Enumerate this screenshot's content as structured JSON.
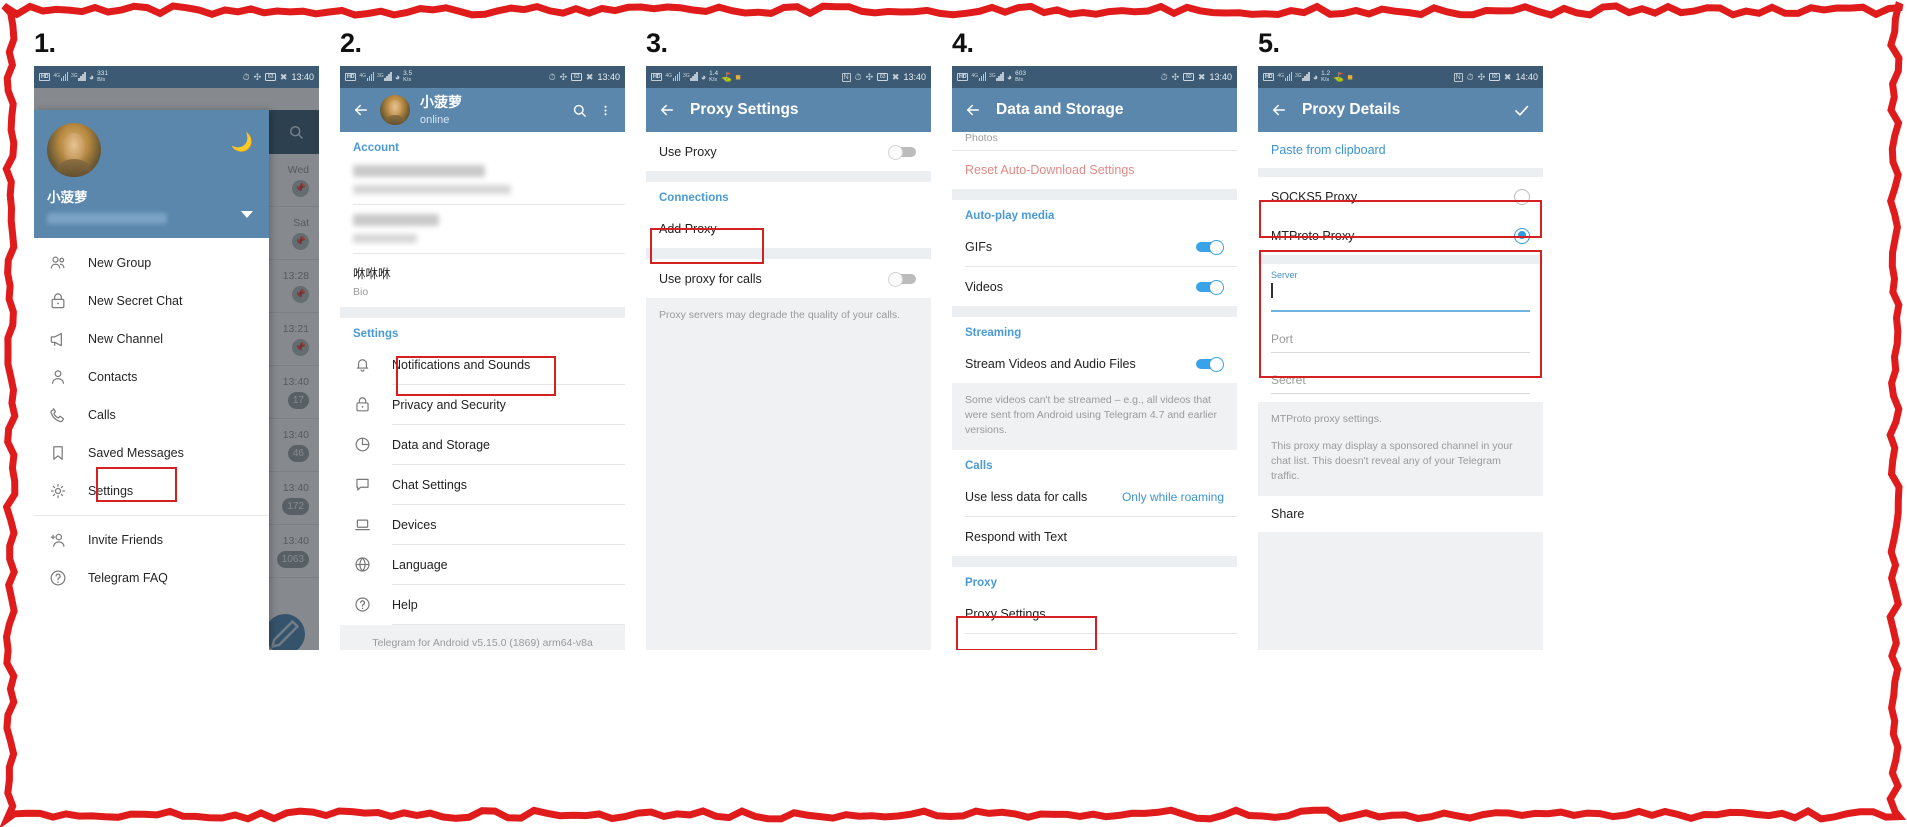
{
  "panels": [
    {
      "step": "1.",
      "status": {
        "rate_value": "331",
        "rate_unit": "B/s",
        "battery": "63",
        "time": "13:40"
      },
      "drawer": {
        "profile_name": "小菠萝",
        "moon_icon": "moon-icon",
        "items": [
          {
            "label": "New Group",
            "icon": "group-icon"
          },
          {
            "label": "New Secret Chat",
            "icon": "lock-icon"
          },
          {
            "label": "New Channel",
            "icon": "megaphone-icon"
          },
          {
            "label": "Contacts",
            "icon": "person-icon"
          },
          {
            "label": "Calls",
            "icon": "phone-icon"
          },
          {
            "label": "Saved Messages",
            "icon": "bookmark-icon"
          },
          {
            "label": "Settings",
            "icon": "gear-icon",
            "highlighted": true
          }
        ],
        "items2": [
          {
            "label": "Invite Friends",
            "icon": "person-add-icon"
          },
          {
            "label": "Telegram FAQ",
            "icon": "help-icon"
          }
        ]
      },
      "chatlist": {
        "rows": [
          {
            "time": "Wed",
            "badge": "pin"
          },
          {
            "time": "Sat",
            "badge": "pin"
          },
          {
            "time": "13:28",
            "badge": "pin"
          },
          {
            "time": "13:21",
            "badge": "pin"
          },
          {
            "time": "13:40",
            "badge": "17"
          },
          {
            "time": "13:40",
            "badge": "46"
          },
          {
            "time": "13:40",
            "badge": "172"
          },
          {
            "time": "13:40",
            "badge": "1063"
          }
        ]
      }
    },
    {
      "step": "2.",
      "status": {
        "rate_value": "3.5",
        "rate_unit": "K/s",
        "battery": "63",
        "time": "13:40"
      },
      "appbar": {
        "name": "小菠萝",
        "status": "online",
        "search_icon": "search-icon",
        "more_icon": "more-vert-icon"
      },
      "account_header": "Account",
      "bio_value": "咻咻咻",
      "bio_label": "Bio",
      "settings_header": "Settings",
      "settings_items": [
        {
          "label": "Notifications and Sounds",
          "icon": "bell-icon"
        },
        {
          "label": "Privacy and Security",
          "icon": "lock-icon"
        },
        {
          "label": "Data and Storage",
          "icon": "pie-icon",
          "highlighted": true
        },
        {
          "label": "Chat Settings",
          "icon": "chat-bubble-icon"
        },
        {
          "label": "Devices",
          "icon": "laptop-icon"
        },
        {
          "label": "Language",
          "icon": "globe-icon"
        },
        {
          "label": "Help",
          "icon": "help-icon"
        }
      ],
      "version": "Telegram for Android v5.15.0 (1869) arm64-v8a"
    },
    {
      "step": "3.",
      "status": {
        "rate_value": "1.4",
        "rate_unit": "K/s",
        "battery": "63",
        "time": "13:40"
      },
      "title": "Proxy Settings",
      "use_proxy_label": "Use Proxy",
      "use_proxy_on": false,
      "connections_header": "Connections",
      "add_proxy_label": "Add Proxy",
      "use_proxy_calls_label": "Use proxy for calls",
      "use_proxy_calls_on": false,
      "note": "Proxy servers may degrade the quality of your calls."
    },
    {
      "step": "4.",
      "status": {
        "rate_value": "603",
        "rate_unit": "B/s",
        "battery": "60",
        "time": "13:40"
      },
      "title": "Data and Storage",
      "photos_label": "Photos",
      "reset_label": "Reset Auto-Download Settings",
      "autoplay_header": "Auto-play media",
      "gifs_label": "GIFs",
      "gifs_on": true,
      "videos_label": "Videos",
      "videos_on": true,
      "streaming_header": "Streaming",
      "stream_label": "Stream Videos and Audio Files",
      "stream_on": true,
      "stream_note": "Some videos can't be streamed – e.g., all videos that were sent from Android using Telegram 4.7 and earlier versions.",
      "calls_header": "Calls",
      "less_data_label": "Use less data for calls",
      "less_data_value": "Only while roaming",
      "respond_label": "Respond with Text",
      "proxy_header": "Proxy",
      "proxy_settings_label": "Proxy Settings"
    },
    {
      "step": "5.",
      "status": {
        "rate_value": "1.2",
        "rate_unit": "K/s",
        "battery": "60",
        "time": "14:40"
      },
      "title": "Proxy Details",
      "check_icon": "check-icon",
      "paste_label": "Paste from clipboard",
      "socks5_label": "SOCKS5 Proxy",
      "socks5_selected": false,
      "mtproto_label": "MTProto Proxy",
      "mtproto_selected": true,
      "server_label": "Server",
      "server_value": "",
      "port_placeholder": "Port",
      "secret_placeholder": "Secret",
      "info_title": "MTProto proxy settings.",
      "info_body": "This proxy may display a sponsored channel in your chat list. This doesn't reveal any of your Telegram traffic.",
      "share_label": "Share"
    }
  ],
  "colors": {
    "appbar": "#5b87ad",
    "statusbar": "#3c5a73",
    "accent": "#4a9ad4",
    "highlight": "#d32020",
    "toggle_on": "#39a2e8",
    "danger": "#e08a86"
  }
}
